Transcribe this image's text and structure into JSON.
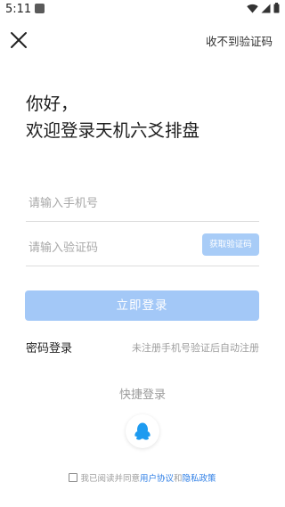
{
  "status_bar": {
    "time": "5:11"
  },
  "header": {
    "no_code_link": "收不到验证码"
  },
  "greeting": {
    "line1": "你好，",
    "line2": "欢迎登录天机六爻排盘"
  },
  "form": {
    "phone_placeholder": "请输入手机号",
    "code_placeholder": "请输入验证码",
    "get_code_label": "获取验证码",
    "login_label": "立即登录"
  },
  "alt_login": {
    "password_login": "密码登录",
    "auto_register_note": "未注册手机号验证后自动注册"
  },
  "quick_login": {
    "title": "快捷登录"
  },
  "agreement": {
    "prefix": "我已阅读并同意",
    "user_agreement": "用户协议",
    "and": "和",
    "privacy_policy": "隐私政策"
  },
  "colors": {
    "accent": "#a3c8f7",
    "link": "#2f7fe6",
    "qq": "#1e9bf0"
  },
  "icons": {
    "close": "close-icon",
    "wifi": "wifi-icon",
    "signal": "signal-icon",
    "battery": "battery-icon",
    "qq": "qq-penguin-icon"
  }
}
